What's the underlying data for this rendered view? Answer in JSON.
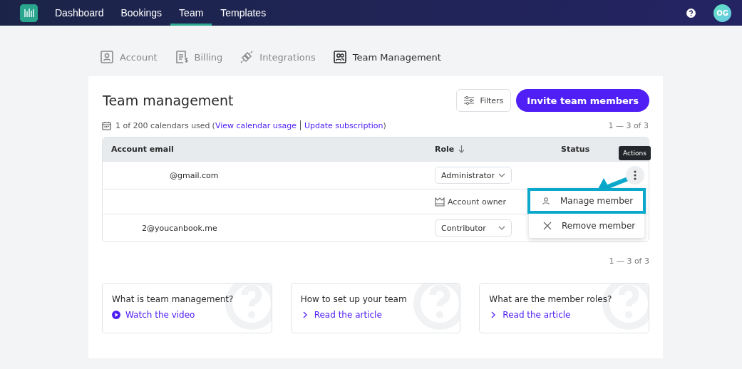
{
  "nav": {
    "items": [
      {
        "label": "Dashboard",
        "selected": false
      },
      {
        "label": "Bookings",
        "selected": false
      },
      {
        "label": "Team",
        "selected": true
      },
      {
        "label": "Templates",
        "selected": false
      }
    ],
    "avatar": "OG"
  },
  "settings_tabs": [
    {
      "label": "Account",
      "kind": "account",
      "selected": false
    },
    {
      "label": "Billing",
      "kind": "billing",
      "selected": false
    },
    {
      "label": "Integrations",
      "kind": "integrations",
      "selected": false
    },
    {
      "label": "Team Management",
      "kind": "team",
      "selected": true
    }
  ],
  "page": {
    "title": "Team management",
    "filters_button": "Filters",
    "invite_button": "Invite team members",
    "usage": {
      "text": "1 of 200 calendars used",
      "open": "(",
      "link_usage": "View calendar usage",
      "link_subscription": "Update subscription",
      "close": ")"
    },
    "pagination_top": "1 — 3 of 3",
    "pagination_bottom": "1 — 3 of 3"
  },
  "table": {
    "columns": [
      {
        "label": "Account email",
        "sorted": false
      },
      {
        "label": "Role",
        "sorted": true
      },
      {
        "label": "Status",
        "sorted": false
      }
    ],
    "rows": [
      {
        "email": "@gmail.com",
        "role": "Administrator",
        "kind": "select"
      },
      {
        "email": "",
        "role": "Account owner",
        "kind": "owner"
      },
      {
        "email": "2@youcanbook.me",
        "role": "Contributor",
        "kind": "select"
      }
    ]
  },
  "tooltip": "Actions",
  "actions_menu": [
    {
      "label": "Manage member",
      "kind": "manage",
      "highlighted": true
    },
    {
      "label": "Remove member",
      "kind": "remove",
      "highlighted": false
    }
  ],
  "help_cards": [
    {
      "title": "What is team management?",
      "link": "Watch the video",
      "kind": "video"
    },
    {
      "title": "How to set up your team",
      "link": "Read the article",
      "kind": "article"
    },
    {
      "title": "What are the member roles?",
      "link": "Read the article",
      "kind": "article"
    }
  ]
}
